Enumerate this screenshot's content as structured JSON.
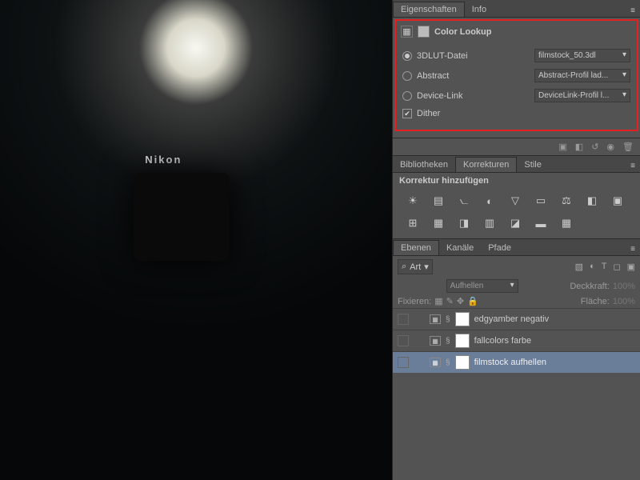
{
  "canvas": {
    "camera_brand": "Nikon"
  },
  "properties_panel": {
    "tabs": {
      "properties": "Eigenschaften",
      "info": "Info"
    },
    "title": "Color Lookup",
    "rows": {
      "lut": {
        "label": "3DLUT-Datei",
        "value": "filmstock_50.3dl"
      },
      "abstract": {
        "label": "Abstract",
        "value": "Abstract-Profil lad..."
      },
      "devicelink": {
        "label": "Device-Link",
        "value": "DeviceLink-Profil l..."
      },
      "dither": {
        "label": "Dither"
      }
    }
  },
  "libraries_panel": {
    "tabs": {
      "bibliotheken": "Bibliotheken",
      "korrekturen": "Korrekturen",
      "stile": "Stile"
    },
    "subtitle": "Korrektur hinzufügen"
  },
  "layers_panel": {
    "tabs": {
      "ebenen": "Ebenen",
      "kanaele": "Kanäle",
      "pfade": "Pfade"
    },
    "search_kind": "Art",
    "blend": {
      "label": "Aufhellen",
      "opacity_label": "Deckkraft:",
      "opacity": "100%"
    },
    "lock": {
      "label": "Fixieren:",
      "fill_label": "Fläche:",
      "fill": "100%"
    },
    "layers": [
      {
        "name": "edgyamber negativ"
      },
      {
        "name": "fallcolors farbe"
      },
      {
        "name": "filmstock aufhellen"
      }
    ]
  }
}
